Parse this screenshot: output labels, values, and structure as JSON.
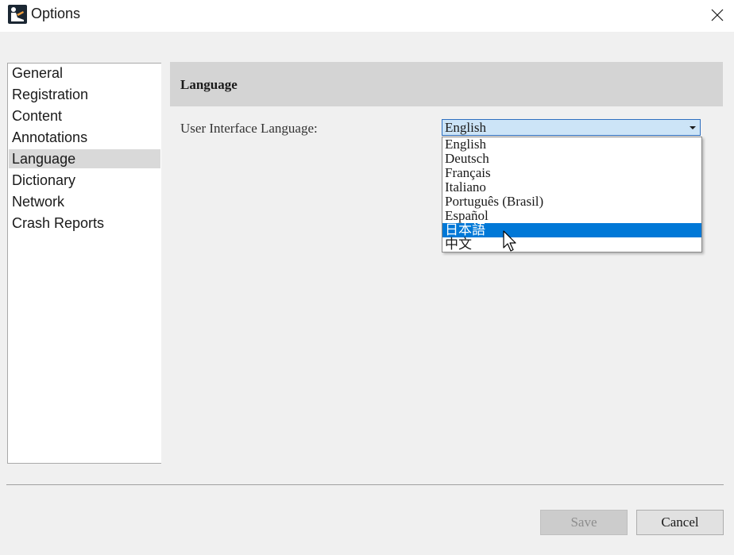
{
  "window": {
    "title": "Options",
    "icon": "kindle-reader-icon",
    "close_icon": "close-icon"
  },
  "sidebar": {
    "items": [
      {
        "label": "General",
        "selected": false
      },
      {
        "label": "Registration",
        "selected": false
      },
      {
        "label": "Content",
        "selected": false
      },
      {
        "label": "Annotations",
        "selected": false
      },
      {
        "label": "Language",
        "selected": true
      },
      {
        "label": "Dictionary",
        "selected": false
      },
      {
        "label": "Network",
        "selected": false
      },
      {
        "label": "Crash Reports",
        "selected": false
      }
    ]
  },
  "section": {
    "title": "Language"
  },
  "language_field": {
    "label": "User Interface Language:",
    "value": "English",
    "options": [
      {
        "label": "English",
        "highlighted": false
      },
      {
        "label": "Deutsch",
        "highlighted": false
      },
      {
        "label": "Français",
        "highlighted": false
      },
      {
        "label": "Italiano",
        "highlighted": false
      },
      {
        "label": "Português (Brasil)",
        "highlighted": false
      },
      {
        "label": "Español",
        "highlighted": false
      },
      {
        "label": "日本語",
        "highlighted": true
      },
      {
        "label": "中文",
        "highlighted": false
      }
    ]
  },
  "footer": {
    "save_label": "Save",
    "save_enabled": false,
    "cancel_label": "Cancel"
  },
  "colors": {
    "highlight": "#0078d7",
    "combo_background": "#cce4f7",
    "header_background": "#d4d4d4"
  }
}
